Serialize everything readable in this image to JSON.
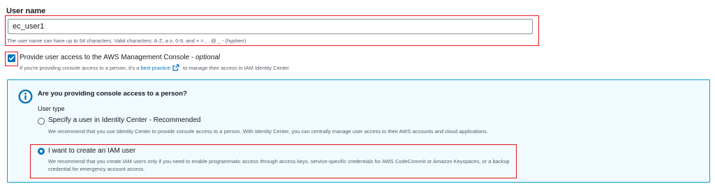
{
  "username": {
    "label": "User name",
    "value": "ec_user1",
    "hint": "The user name can have up to 64 characters. Valid characters: A-Z, a-z, 0-9, and + = , . @ _ - (hyphen)"
  },
  "console_access": {
    "checked": true,
    "label": "Provide user access to the AWS Management Console - ",
    "optional": "optional",
    "desc_prefix": "If you're providing console access to a person, it's a ",
    "link": "best practice",
    "desc_suffix": " to manage their access in IAM Identity Center."
  },
  "info_panel": {
    "icon": "info-icon",
    "title": "Are you providing console access to a person?",
    "user_type_label": "User type",
    "options": [
      {
        "label": "Specify a user in Identity Center - Recommended",
        "desc": "We recommend that you use Identity Center to provide console access to a person. With Identity Center, you can centrally manage user access to their AWS accounts and cloud applications.",
        "selected": false
      },
      {
        "label": "I want to create an IAM user",
        "desc": "We recommend that you create IAM users only if you need to enable programmatic access through access keys, service-specific credentials for AWS CodeCommit or Amazon Keyspaces, or a backup credential for emergency account access.",
        "selected": true
      }
    ]
  },
  "colors": {
    "accent": "#0073bb",
    "highlight": "#e0161c",
    "panel_bg": "#f1faff",
    "panel_border": "#00a1c9"
  }
}
